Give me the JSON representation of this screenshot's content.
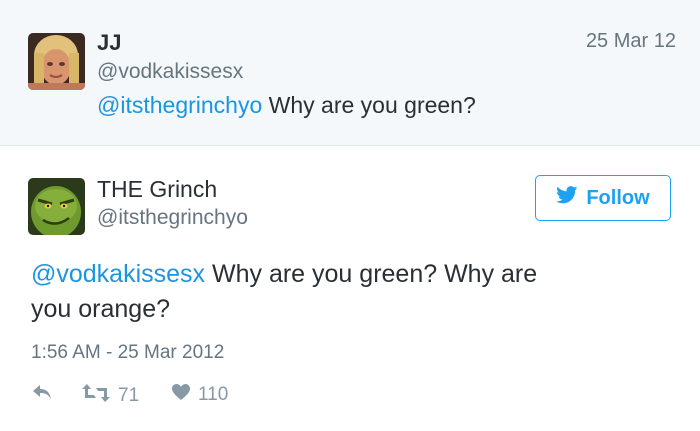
{
  "reply_tweet": {
    "name": "JJ",
    "handle": "@vodkakissesx",
    "date": "25 Mar 12",
    "mention": "@itsthegrinchyo",
    "text": " Why are you green?"
  },
  "main_tweet": {
    "name": "THE Grinch",
    "handle": "@itsthegrinchyo",
    "follow_label": "Follow",
    "mention": "@vodkakissesx",
    "text": " Why are you green? Why are you orange?",
    "timestamp": "1:56 AM - 25 Mar 2012",
    "retweets": "71",
    "likes": "110"
  },
  "colors": {
    "link": "#1b95e0",
    "twitter_blue": "#1da1f2",
    "muted": "#66757f",
    "header_bg": "#f5f8fa"
  }
}
